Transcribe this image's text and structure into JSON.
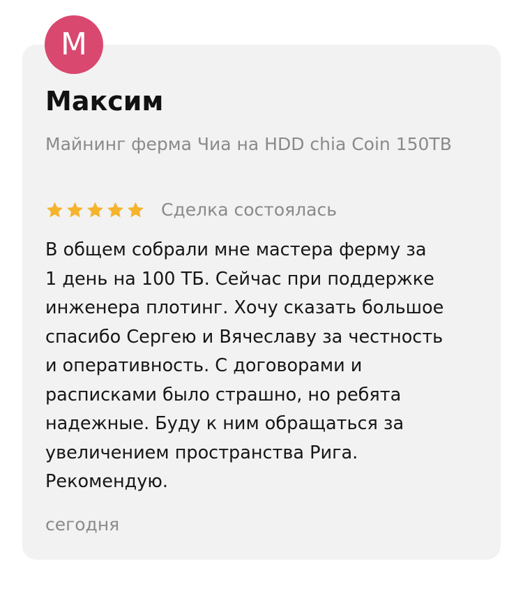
{
  "avatar": {
    "initial": "М",
    "color": "#d9486f"
  },
  "author": {
    "name": "Максим"
  },
  "product": {
    "title": "Майнинг ферма Чиа на HDD chia Coin 150TB"
  },
  "rating": {
    "value": 5,
    "max": 5,
    "star_color": "#f5b32e",
    "status": "Сделка состоялась"
  },
  "review": {
    "lines": [
      "В общем собрали мне мастера ферму за",
      "1 день на 100 ТБ. Сейчас при поддержке",
      "инженера плотинг. Хочу сказать большое",
      "спасибо Сергею и Вячеславу за честность",
      "и оперативность. С договорами и",
      "расписками было страшно, но ребята",
      "надежные. Буду к ним обращаться за",
      "увеличением пространства Рига.",
      "Рекомендую."
    ]
  },
  "date": "сегодня"
}
